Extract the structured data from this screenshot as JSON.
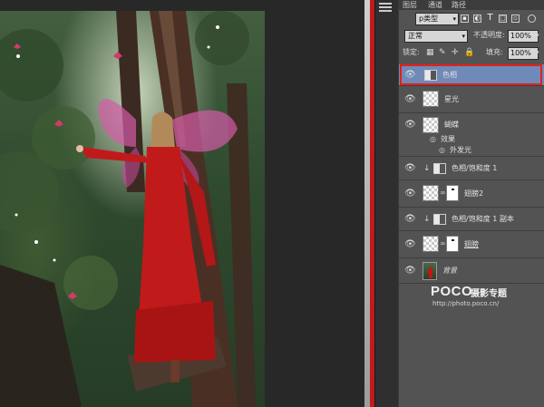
{
  "panel": {
    "tabs": [
      "图层",
      "通道",
      "路径"
    ],
    "filter": {
      "label": "p类型",
      "icons": [
        "pixel-filter-icon",
        "adjustment-filter-icon",
        "type-filter-icon",
        "shape-filter-icon",
        "smartobject-filter-icon"
      ]
    },
    "blend_mode": "正常",
    "opacity_label": "不透明度:",
    "opacity_value": "100%",
    "lock_label": "锁定:",
    "fill_label": "填充:",
    "fill_value": "100%"
  },
  "layers": [
    {
      "name": "色相",
      "kind": "adjustment",
      "selected": true
    },
    {
      "name": "星光",
      "kind": "pixel"
    },
    {
      "name": "蝴蝶",
      "kind": "pixel",
      "effects_label": "效果",
      "effects": [
        "外发光"
      ]
    },
    {
      "name": "色相/饱和度 1",
      "kind": "adjustment-clipped"
    },
    {
      "name": "翅膀2",
      "kind": "pixel-mask"
    },
    {
      "name": "色相/饱和度 1 副本",
      "kind": "adjustment-clipped"
    },
    {
      "name": "翅膀",
      "kind": "pixel-mask"
    },
    {
      "name": "背景",
      "kind": "background"
    }
  ],
  "watermark": {
    "brand": "POCO",
    "title": "摄影专题",
    "url": "http://photo.poco.cn/"
  },
  "colors": {
    "selection": "#6f89b8",
    "highlight_box": "#e3201b",
    "dress": "#c11a1a"
  }
}
